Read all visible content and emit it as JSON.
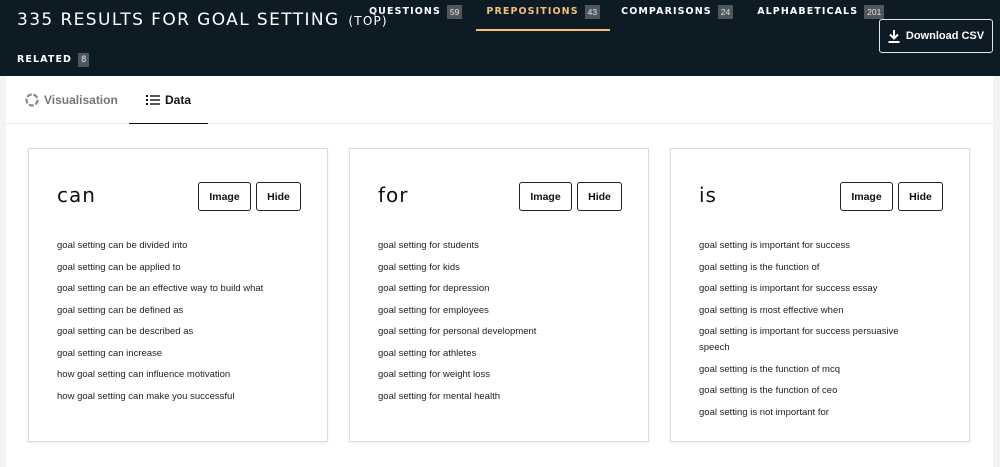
{
  "header": {
    "title": "335 RESULTS FOR GOAL SETTING",
    "title_suffix": "(TOP)",
    "download_label": "Download CSV"
  },
  "tabs": [
    {
      "label": "QUESTIONS",
      "count": "59",
      "active": false
    },
    {
      "label": "PREPOSITIONS",
      "count": "43",
      "active": true
    },
    {
      "label": "COMPARISONS",
      "count": "24",
      "active": false
    },
    {
      "label": "ALPHABETICALS",
      "count": "201",
      "active": false
    }
  ],
  "related": {
    "label": "RELATED",
    "count": "8"
  },
  "view_tabs": {
    "visualisation": "Visualisation",
    "data": "Data"
  },
  "buttons": {
    "image": "Image",
    "hide": "Hide"
  },
  "cards": [
    {
      "heading": "can",
      "items": [
        "goal setting can be divided into",
        "goal setting can be applied to",
        "goal setting can be an effective way to build what",
        "goal setting can be defined as",
        "goal setting can be described as",
        "goal setting can increase",
        "how goal setting can influence motivation",
        "how goal setting can make you successful"
      ]
    },
    {
      "heading": "for",
      "items": [
        "goal setting for students",
        "goal setting for kids",
        "goal setting for depression",
        "goal setting for employees",
        "goal setting for personal development",
        "goal setting for athletes",
        "goal setting for weight loss",
        "goal setting for mental health"
      ]
    },
    {
      "heading": "is",
      "items": [
        "goal setting is important for success",
        "goal setting is the function of",
        "goal setting is important for success essay",
        "goal setting is most effective when",
        "goal setting is important for success persuasive speech",
        "goal setting is the function of mcq",
        "goal setting is the function of ceo",
        "goal setting is not important for"
      ]
    }
  ],
  "colors": {
    "header_bg": "#0d1b24",
    "accent": "#f3c07a",
    "count_badge": "#4f565c"
  }
}
